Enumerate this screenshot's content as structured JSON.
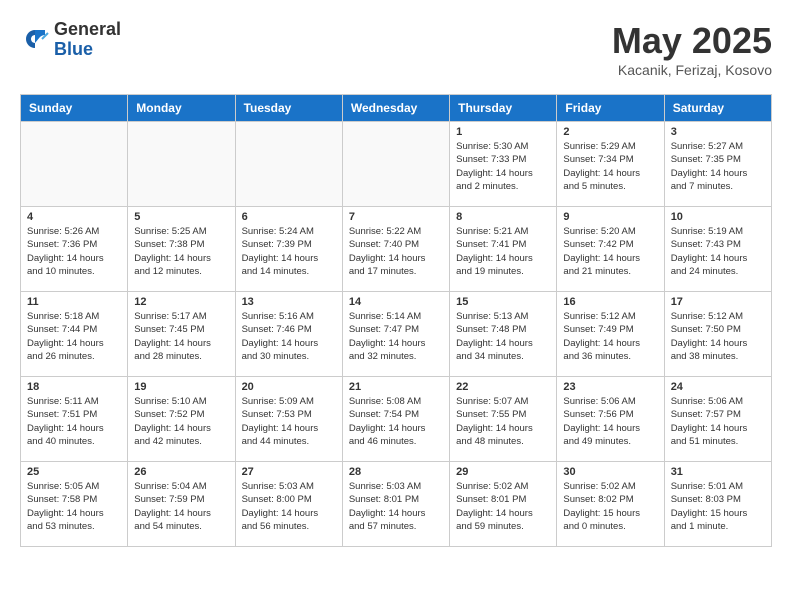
{
  "header": {
    "logo_general": "General",
    "logo_blue": "Blue",
    "title": "May 2025",
    "location": "Kacanik, Ferizaj, Kosovo"
  },
  "weekdays": [
    "Sunday",
    "Monday",
    "Tuesday",
    "Wednesday",
    "Thursday",
    "Friday",
    "Saturday"
  ],
  "weeks": [
    [
      {
        "day": "",
        "info": ""
      },
      {
        "day": "",
        "info": ""
      },
      {
        "day": "",
        "info": ""
      },
      {
        "day": "",
        "info": ""
      },
      {
        "day": "1",
        "info": "Sunrise: 5:30 AM\nSunset: 7:33 PM\nDaylight: 14 hours\nand 2 minutes."
      },
      {
        "day": "2",
        "info": "Sunrise: 5:29 AM\nSunset: 7:34 PM\nDaylight: 14 hours\nand 5 minutes."
      },
      {
        "day": "3",
        "info": "Sunrise: 5:27 AM\nSunset: 7:35 PM\nDaylight: 14 hours\nand 7 minutes."
      }
    ],
    [
      {
        "day": "4",
        "info": "Sunrise: 5:26 AM\nSunset: 7:36 PM\nDaylight: 14 hours\nand 10 minutes."
      },
      {
        "day": "5",
        "info": "Sunrise: 5:25 AM\nSunset: 7:38 PM\nDaylight: 14 hours\nand 12 minutes."
      },
      {
        "day": "6",
        "info": "Sunrise: 5:24 AM\nSunset: 7:39 PM\nDaylight: 14 hours\nand 14 minutes."
      },
      {
        "day": "7",
        "info": "Sunrise: 5:22 AM\nSunset: 7:40 PM\nDaylight: 14 hours\nand 17 minutes."
      },
      {
        "day": "8",
        "info": "Sunrise: 5:21 AM\nSunset: 7:41 PM\nDaylight: 14 hours\nand 19 minutes."
      },
      {
        "day": "9",
        "info": "Sunrise: 5:20 AM\nSunset: 7:42 PM\nDaylight: 14 hours\nand 21 minutes."
      },
      {
        "day": "10",
        "info": "Sunrise: 5:19 AM\nSunset: 7:43 PM\nDaylight: 14 hours\nand 24 minutes."
      }
    ],
    [
      {
        "day": "11",
        "info": "Sunrise: 5:18 AM\nSunset: 7:44 PM\nDaylight: 14 hours\nand 26 minutes."
      },
      {
        "day": "12",
        "info": "Sunrise: 5:17 AM\nSunset: 7:45 PM\nDaylight: 14 hours\nand 28 minutes."
      },
      {
        "day": "13",
        "info": "Sunrise: 5:16 AM\nSunset: 7:46 PM\nDaylight: 14 hours\nand 30 minutes."
      },
      {
        "day": "14",
        "info": "Sunrise: 5:14 AM\nSunset: 7:47 PM\nDaylight: 14 hours\nand 32 minutes."
      },
      {
        "day": "15",
        "info": "Sunrise: 5:13 AM\nSunset: 7:48 PM\nDaylight: 14 hours\nand 34 minutes."
      },
      {
        "day": "16",
        "info": "Sunrise: 5:12 AM\nSunset: 7:49 PM\nDaylight: 14 hours\nand 36 minutes."
      },
      {
        "day": "17",
        "info": "Sunrise: 5:12 AM\nSunset: 7:50 PM\nDaylight: 14 hours\nand 38 minutes."
      }
    ],
    [
      {
        "day": "18",
        "info": "Sunrise: 5:11 AM\nSunset: 7:51 PM\nDaylight: 14 hours\nand 40 minutes."
      },
      {
        "day": "19",
        "info": "Sunrise: 5:10 AM\nSunset: 7:52 PM\nDaylight: 14 hours\nand 42 minutes."
      },
      {
        "day": "20",
        "info": "Sunrise: 5:09 AM\nSunset: 7:53 PM\nDaylight: 14 hours\nand 44 minutes."
      },
      {
        "day": "21",
        "info": "Sunrise: 5:08 AM\nSunset: 7:54 PM\nDaylight: 14 hours\nand 46 minutes."
      },
      {
        "day": "22",
        "info": "Sunrise: 5:07 AM\nSunset: 7:55 PM\nDaylight: 14 hours\nand 48 minutes."
      },
      {
        "day": "23",
        "info": "Sunrise: 5:06 AM\nSunset: 7:56 PM\nDaylight: 14 hours\nand 49 minutes."
      },
      {
        "day": "24",
        "info": "Sunrise: 5:06 AM\nSunset: 7:57 PM\nDaylight: 14 hours\nand 51 minutes."
      }
    ],
    [
      {
        "day": "25",
        "info": "Sunrise: 5:05 AM\nSunset: 7:58 PM\nDaylight: 14 hours\nand 53 minutes."
      },
      {
        "day": "26",
        "info": "Sunrise: 5:04 AM\nSunset: 7:59 PM\nDaylight: 14 hours\nand 54 minutes."
      },
      {
        "day": "27",
        "info": "Sunrise: 5:03 AM\nSunset: 8:00 PM\nDaylight: 14 hours\nand 56 minutes."
      },
      {
        "day": "28",
        "info": "Sunrise: 5:03 AM\nSunset: 8:01 PM\nDaylight: 14 hours\nand 57 minutes."
      },
      {
        "day": "29",
        "info": "Sunrise: 5:02 AM\nSunset: 8:01 PM\nDaylight: 14 hours\nand 59 minutes."
      },
      {
        "day": "30",
        "info": "Sunrise: 5:02 AM\nSunset: 8:02 PM\nDaylight: 15 hours\nand 0 minutes."
      },
      {
        "day": "31",
        "info": "Sunrise: 5:01 AM\nSunset: 8:03 PM\nDaylight: 15 hours\nand 1 minute."
      }
    ]
  ]
}
